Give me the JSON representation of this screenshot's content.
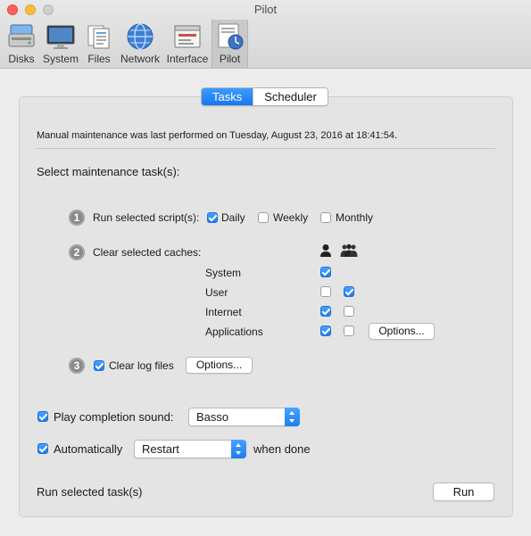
{
  "window": {
    "title": "Pilot"
  },
  "toolbar": {
    "items": [
      {
        "label": "Disks",
        "icon": "disks-icon"
      },
      {
        "label": "System",
        "icon": "system-icon"
      },
      {
        "label": "Files",
        "icon": "files-icon"
      },
      {
        "label": "Network",
        "icon": "network-icon"
      },
      {
        "label": "Interface",
        "icon": "interface-icon"
      },
      {
        "label": "Pilot",
        "icon": "pilot-icon",
        "selected": true
      }
    ]
  },
  "tabs": [
    {
      "label": "Tasks",
      "active": true
    },
    {
      "label": "Scheduler",
      "active": false
    }
  ],
  "main": {
    "last_performed": "Manual maintenance was last performed on Tuesday, August 23, 2016 at 18:41:54.",
    "select_heading": "Select maintenance task(s):",
    "step1": {
      "number": "1",
      "label": "Run selected script(s):",
      "options": [
        {
          "label": "Daily",
          "checked": true
        },
        {
          "label": "Weekly",
          "checked": false
        },
        {
          "label": "Monthly",
          "checked": false
        }
      ]
    },
    "step2": {
      "number": "2",
      "label": "Clear selected caches:",
      "column_icons": [
        "single-user-icon",
        "all-users-icon"
      ],
      "rows": [
        {
          "label": "System",
          "user": true,
          "all": null
        },
        {
          "label": "User",
          "user": false,
          "all": true
        },
        {
          "label": "Internet",
          "user": true,
          "all": false
        },
        {
          "label": "Applications",
          "user": true,
          "all": false
        }
      ],
      "options_button": "Options..."
    },
    "step3": {
      "number": "3",
      "label": "Clear log files",
      "checked": true,
      "options_button": "Options..."
    },
    "completion_sound": {
      "label": "Play completion sound:",
      "checked": true,
      "value": "Basso"
    },
    "automatically": {
      "label": "Automatically",
      "checked": true,
      "value": "Restart",
      "suffix": "when done"
    },
    "run_label": "Run selected task(s)",
    "run_button": "Run"
  },
  "colors": {
    "accent": "#1b7df0",
    "panel": "#e4e4e4",
    "window": "#ececec"
  }
}
